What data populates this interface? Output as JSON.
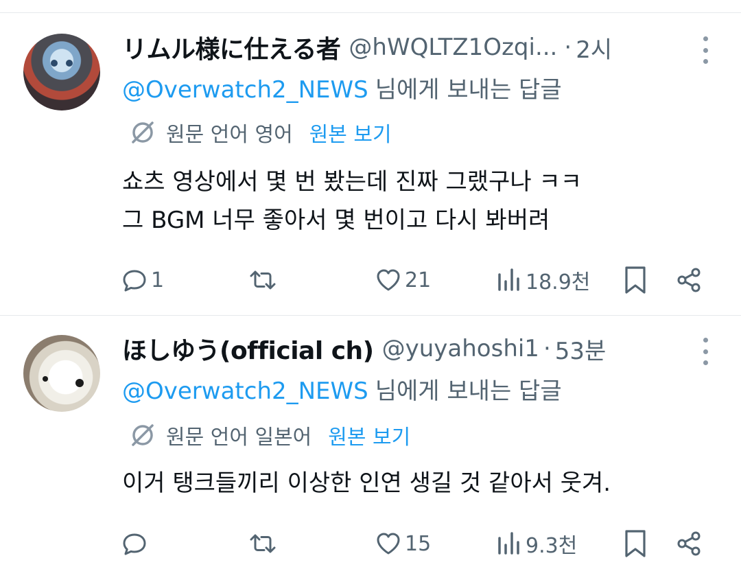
{
  "tweets": [
    {
      "name": "リムル様に仕える者",
      "handle": "@hWQLTZ1Ozqi...",
      "separator": "·",
      "time": "2시",
      "reply_mention": "@Overwatch2_NEWS",
      "reply_suffix": "님에게 보내는 답글",
      "translate_label": "원문 언어 영어",
      "show_original": "원본 보기",
      "lines": [
        "쇼츠 영상에서 몇 번 봤는데 진짜 그랬구나 ㅋㅋ",
        "그 BGM 너무 좋아서 몇 번이고 다시 봐버려"
      ],
      "replies": "1",
      "retweets": "",
      "likes": "21",
      "views": "18.9천"
    },
    {
      "name": "ほしゆう(official ch)",
      "handle": "@yuyahoshi1",
      "separator": "·",
      "time": "53분",
      "reply_mention": "@Overwatch2_NEWS",
      "reply_suffix": "님에게 보내는 답글",
      "translate_label": "원문 언어 일본어",
      "show_original": "원본 보기",
      "lines": [
        "이거 탱크들끼리 이상한 인연 생길 것 같아서 웃겨."
      ],
      "replies": "",
      "retweets": "",
      "likes": "15",
      "views": "9.3천"
    }
  ],
  "icons": {
    "reply": "reply-icon",
    "retweet": "retweet-icon",
    "like": "heart-icon",
    "views": "views-icon",
    "bookmark": "bookmark-icon",
    "share": "share-icon",
    "translate": "translate-icon",
    "more": "more-icon"
  },
  "colors": {
    "accent": "#1d9bf0",
    "secondary": "#536471",
    "text": "#0f1419",
    "divider": "#e6e9ec"
  }
}
